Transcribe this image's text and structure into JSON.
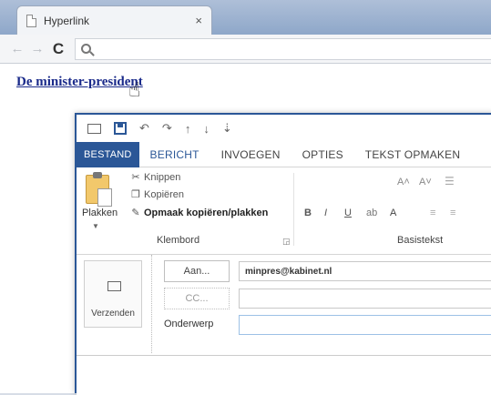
{
  "browser": {
    "tab_title": "Hyperlink",
    "close_glyph": "×",
    "back_glyph": "←",
    "forward_glyph": "→",
    "reload_glyph": "C"
  },
  "page": {
    "link_text": "De minister-president",
    "cursor_glyph": "☝"
  },
  "outlook": {
    "qat": {
      "undo": "↶",
      "redo": "↷",
      "up": "↑",
      "down": "↓",
      "more": "⇣"
    },
    "tabs": [
      "BESTAND",
      "BERICHT",
      "INVOEGEN",
      "OPTIES",
      "TEKST OPMAKEN"
    ],
    "clipboard": {
      "paste": "Plakken",
      "cut": "Knippen",
      "copy": "Kopiëren",
      "format_painter": "Opmaak kopiëren/plakken",
      "group": "Klembord"
    },
    "basic_text": {
      "group": "Basistekst",
      "bold": "B",
      "italic": "I",
      "underline": "U",
      "highlight": "ab",
      "font_color": "A",
      "grow": "A˄",
      "shrink": "A˅",
      "list": "☰",
      "indent1": "≡",
      "indent2": "≡"
    },
    "mail": {
      "send": "Verzenden",
      "to_button": "Aan...",
      "cc_button": "CC...",
      "subject_label": "Onderwerp",
      "to_value": "minpres@kabinet.nl",
      "cc_value": "",
      "subject_value": ""
    }
  }
}
